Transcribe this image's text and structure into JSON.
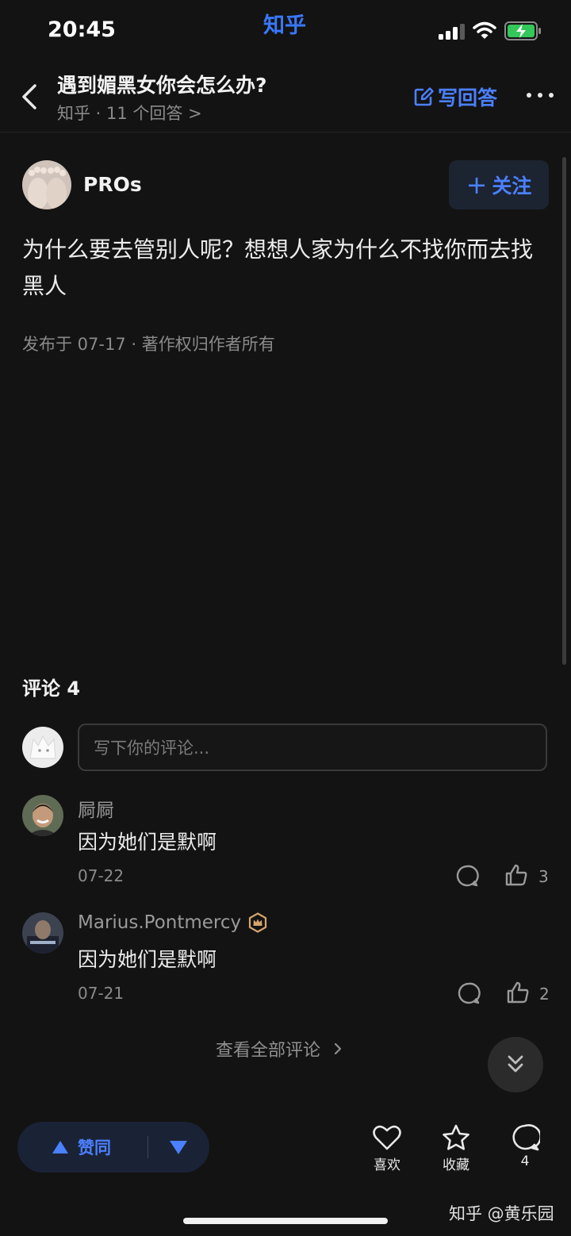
{
  "status_bar": {
    "time": "20:45",
    "brand": "知乎"
  },
  "header": {
    "title": "遇到媚黑女你会怎么办?",
    "subtitle": "知乎 · 11 个回答 >",
    "write_answer_label": "写回答"
  },
  "answer": {
    "author_name": "PROs",
    "follow_label": "关注",
    "content": "为什么要去管别人呢？想想人家为什么不找你而去找黑人",
    "meta": "发布于 07-17 · 著作权归作者所有"
  },
  "comments_section": {
    "header": "评论 4",
    "input_placeholder": "写下你的评论...",
    "items": [
      {
        "user": "屙屙",
        "text": "因为她们是默啊",
        "date": "07-22",
        "likes": "3",
        "badge": false
      },
      {
        "user": "Marius.Pontmercy",
        "text": "因为她们是默啊",
        "date": "07-21",
        "likes": "2",
        "badge": true
      }
    ],
    "view_all_label": "查看全部评论"
  },
  "bottom_bar": {
    "upvote_label": "赞同",
    "like_label": "喜欢",
    "favorite_label": "收藏",
    "comment_count": "4"
  },
  "watermark": "知乎 @黄乐园",
  "colors": {
    "accent": "#4b80ff",
    "background": "#131313",
    "text": "#e8e8e8",
    "muted": "#8a8a8a"
  },
  "icons": [
    "back-icon",
    "edit-icon",
    "more-icon",
    "plus-icon",
    "comment-icon",
    "thumb-up-icon",
    "chevron-right-icon",
    "double-chevron-down-icon",
    "triangle-up-icon",
    "triangle-down-icon",
    "heart-icon",
    "star-icon",
    "crown-badge-icon"
  ]
}
